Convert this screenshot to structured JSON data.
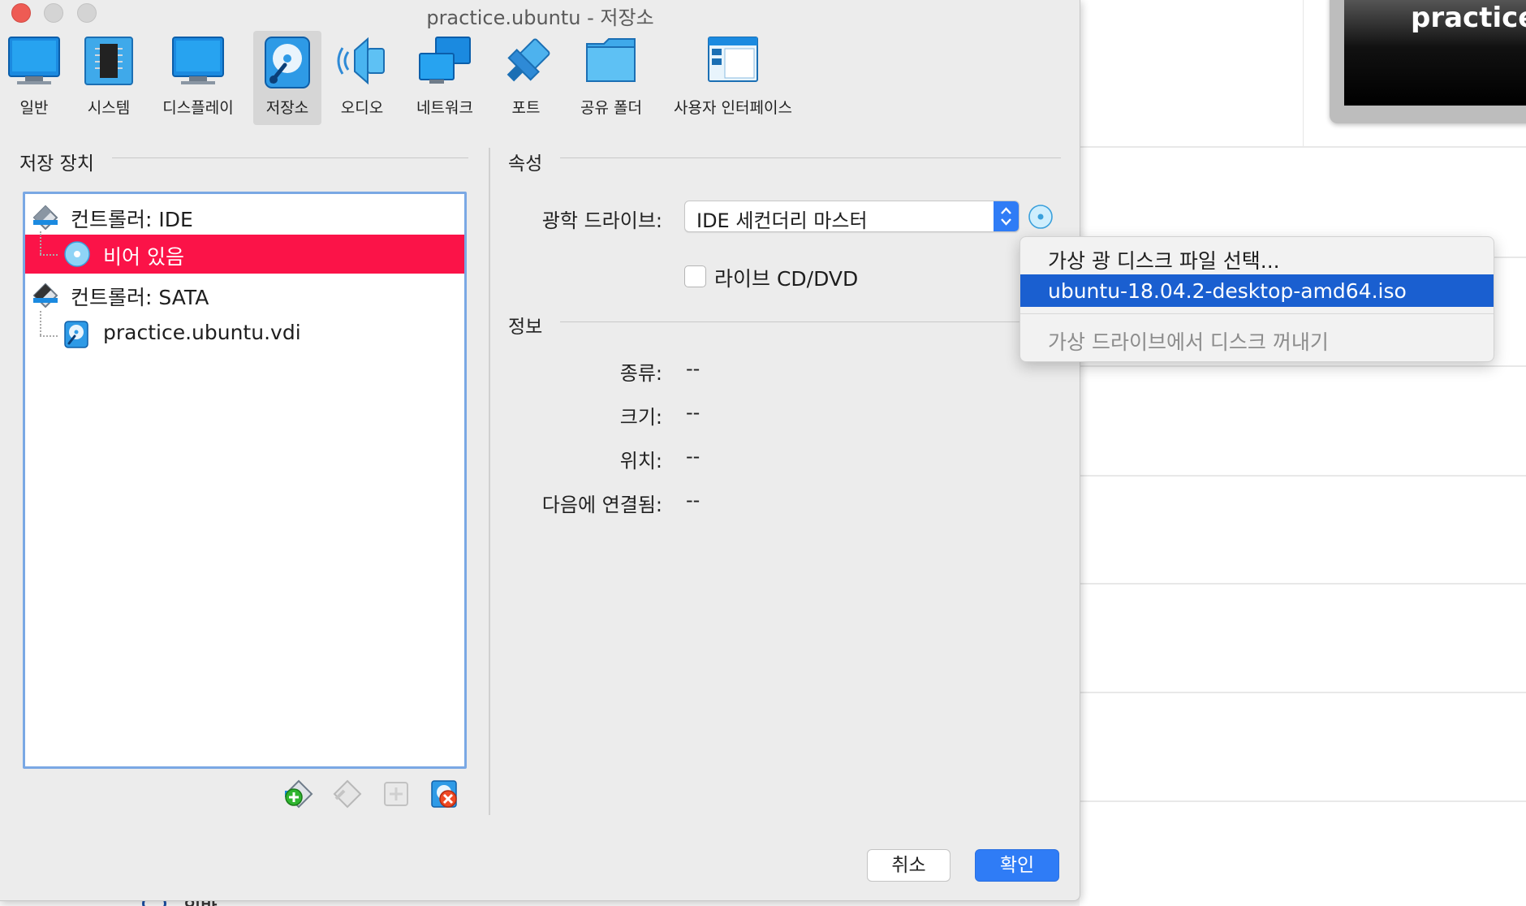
{
  "window": {
    "title": "practice.ubuntu - 저장소"
  },
  "background": {
    "preview_title": "practice.u",
    "bottom_text": "일반"
  },
  "toolbar": {
    "items": [
      {
        "label": "일반",
        "icon": "monitor-icon"
      },
      {
        "label": "시스템",
        "icon": "chip-icon"
      },
      {
        "label": "디스플레이",
        "icon": "display-icon"
      },
      {
        "label": "저장소",
        "icon": "storage-icon",
        "active": true
      },
      {
        "label": "오디오",
        "icon": "speaker-icon"
      },
      {
        "label": "네트워크",
        "icon": "network-icon"
      },
      {
        "label": "포트",
        "icon": "port-icon"
      },
      {
        "label": "공유 폴더",
        "icon": "folder-icon"
      },
      {
        "label": "사용자 인터페이스",
        "icon": "ui-window-icon"
      }
    ]
  },
  "storage": {
    "heading": "저장 장치",
    "tree": [
      {
        "label": "컨트롤러: IDE",
        "type": "controller"
      },
      {
        "label": "비어 있음",
        "type": "optical",
        "selected": true
      },
      {
        "label": "컨트롤러: SATA",
        "type": "controller"
      },
      {
        "label": "practice.ubuntu.vdi",
        "type": "disk"
      }
    ]
  },
  "attributes": {
    "heading": "속성",
    "optical_drive_label": "광학 드라이브:",
    "optical_drive_value": "IDE 세컨더리 마스터",
    "live_cd_label": "라이브 CD/DVD",
    "live_cd_checked": false
  },
  "info": {
    "heading": "정보",
    "rows": [
      {
        "label": "종류:",
        "value": "--"
      },
      {
        "label": "크기:",
        "value": "--"
      },
      {
        "label": "위치:",
        "value": "--"
      },
      {
        "label": "다음에 연결됨:",
        "value": "--"
      }
    ]
  },
  "dropdown": {
    "items": [
      {
        "label": "가상 광 디스크 파일 선택..."
      },
      {
        "label": "ubuntu-18.04.2-desktop-amd64.iso",
        "highlight": true
      },
      {
        "label": "가상 드라이브에서 디스크 꺼내기",
        "disabled": true
      }
    ]
  },
  "buttons": {
    "cancel": "취소",
    "ok": "확인"
  },
  "colors": {
    "accent": "#2f7cf6",
    "selection": "#fb1348",
    "menu_highlight": "#1a5fd0"
  }
}
